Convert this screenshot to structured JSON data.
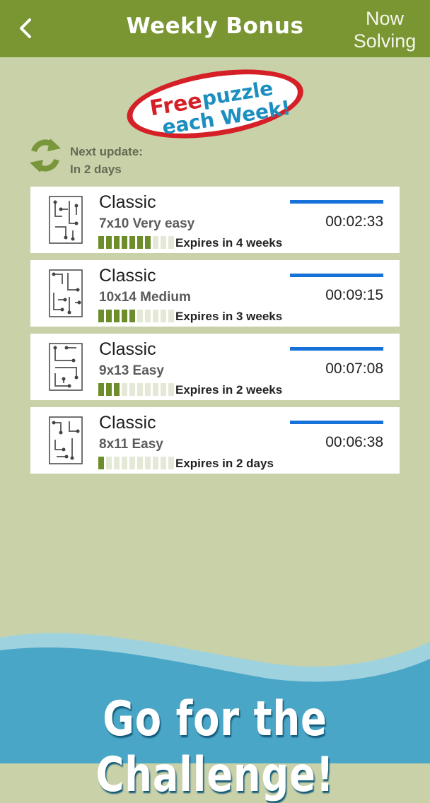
{
  "header": {
    "back_icon": "chevron-left-icon",
    "title": "Weekly Bonus",
    "now_solving_line1": "Now",
    "now_solving_line2": "Solving"
  },
  "badge": {
    "line1_red": "Free",
    "line1_blue": "puzzle",
    "line2": "each Week!"
  },
  "update": {
    "icon": "refresh-icon",
    "line1": "Next update:",
    "line2": "In 2 days"
  },
  "puzzles": [
    {
      "title": "Classic",
      "subtitle": "7x10 Very easy",
      "expires": "Expires in 4 weeks",
      "time": "00:02:33",
      "remaining": 0.7
    },
    {
      "title": "Classic",
      "subtitle": "10x14 Medium",
      "expires": "Expires in 3 weeks",
      "time": "00:09:15",
      "remaining": 0.5
    },
    {
      "title": "Classic",
      "subtitle": "9x13 Easy",
      "expires": "Expires in 2 weeks",
      "time": "00:07:08",
      "remaining": 0.3
    },
    {
      "title": "Classic",
      "subtitle": "8x11 Easy",
      "expires": "Expires in 2 days",
      "time": "00:06:38",
      "remaining": 0.1
    }
  ],
  "footer": {
    "text": "Go for the Challenge!"
  },
  "colors": {
    "header_bg": "#7a9633",
    "page_bg": "#c9d1a9",
    "progress_on": "#6d8c2a",
    "progress_off": "#e4e8d6",
    "timer_bar": "#1671d9"
  }
}
